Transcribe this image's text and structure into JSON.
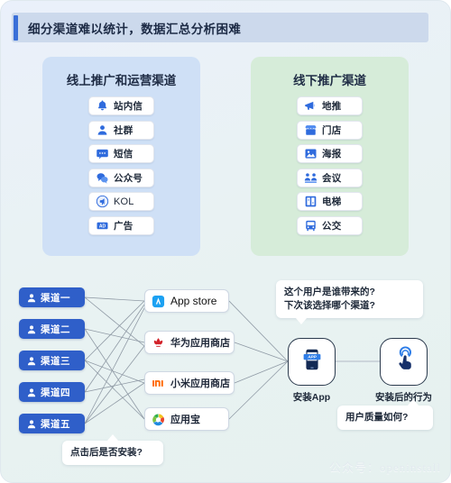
{
  "banner": {
    "title": "细分渠道难以统计，数据汇总分析困难",
    "accent_color": "#3a6fd8",
    "background_color": "#ccd9ec"
  },
  "groups": {
    "online": {
      "title": "线上推广和运营渠道",
      "background_color": "#cfe0f6",
      "items": [
        {
          "label": "站内信",
          "icon": "bell-icon"
        },
        {
          "label": "社群",
          "icon": "user-group-icon"
        },
        {
          "label": "短信",
          "icon": "sms-message-icon"
        },
        {
          "label": "公众号",
          "icon": "wechat-official-account-icon"
        },
        {
          "label": "KOL",
          "icon": "kol-megaphone-icon"
        },
        {
          "label": "广告",
          "icon": "ad-banner-icon"
        }
      ]
    },
    "offline": {
      "title": "线下推广渠道",
      "background_color": "#d6ecd9",
      "items": [
        {
          "label": "地推",
          "icon": "megaphone-icon"
        },
        {
          "label": "门店",
          "icon": "storefront-icon"
        },
        {
          "label": "海报",
          "icon": "poster-image-icon"
        },
        {
          "label": "会议",
          "icon": "conference-icon"
        },
        {
          "label": "电梯",
          "icon": "elevator-icon"
        },
        {
          "label": "公交",
          "icon": "bus-icon"
        }
      ]
    }
  },
  "flow": {
    "channels": [
      {
        "label": "渠道一",
        "icon": "user-icon"
      },
      {
        "label": "渠道二",
        "icon": "user-icon"
      },
      {
        "label": "渠道三",
        "icon": "user-icon"
      },
      {
        "label": "渠道四",
        "icon": "user-icon"
      },
      {
        "label": "渠道五",
        "icon": "user-icon"
      }
    ],
    "stores": [
      {
        "label": "App store",
        "icon": "app-store-icon",
        "latin": true
      },
      {
        "label": "华为应用商店",
        "icon": "huawei-appgallery-icon",
        "latin": false
      },
      {
        "label": "小米应用商店",
        "icon": "xiaomi-mi-store-icon",
        "latin": false
      },
      {
        "label": "应用宝",
        "icon": "tencent-myapp-icon",
        "latin": false
      }
    ],
    "nodes": [
      {
        "label": "安装App",
        "icon": "install-app-phone-icon"
      },
      {
        "label": "安装后的行为",
        "icon": "tap-hand-icon"
      }
    ],
    "bubbles": [
      {
        "id": "install-question",
        "lines": [
          "点击后是否安装?"
        ]
      },
      {
        "id": "attribution-question",
        "lines": [
          "这个用户是谁带来的?",
          "下次该选择哪个渠道?"
        ]
      },
      {
        "id": "quality-question",
        "lines": [
          "用户质量如何?"
        ]
      }
    ]
  },
  "watermark": "公众号：openinstall"
}
